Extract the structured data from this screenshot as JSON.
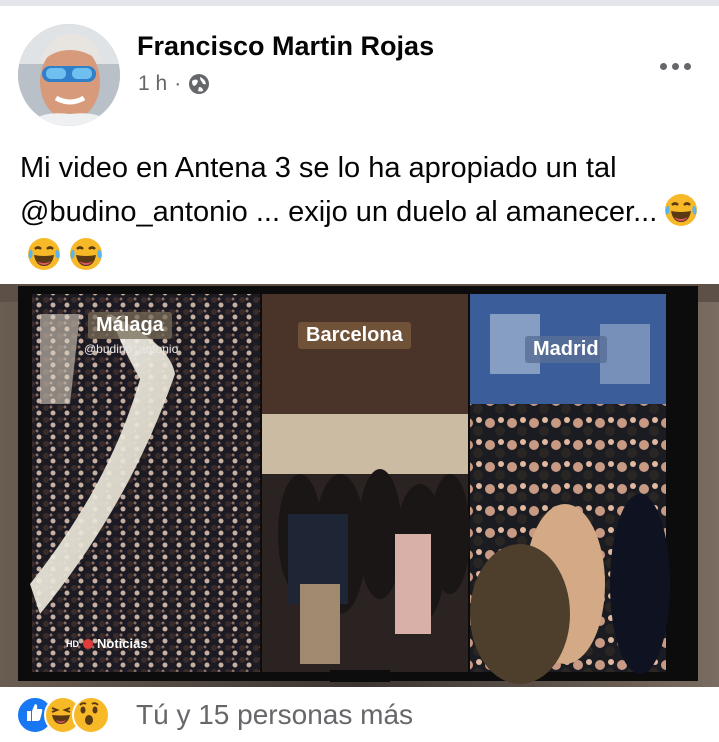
{
  "post": {
    "author": "Francisco Martin Rojas",
    "time": "1 h",
    "separator": "·",
    "text": "Mi video en Antena 3 se lo ha apropiado un tal @budino_antonio ... exijo un duelo al amanecer...",
    "emojis": [
      "laughing-tears-icon",
      "laughing-tears-icon",
      "laughing-tears-icon"
    ]
  },
  "photo": {
    "panels": [
      {
        "city": "Málaga"
      },
      {
        "city": "Barcelona"
      },
      {
        "city": "Madrid"
      }
    ],
    "watermark": "@budino_antonio",
    "logo": "Noticias",
    "logo_hd": "HD"
  },
  "reactions": {
    "icons": [
      "like-icon",
      "haha-icon",
      "wow-icon"
    ],
    "summary": "Tú y 15 personas más"
  },
  "colors": {
    "like_blue": "#1877f2",
    "haha_yellow": "#f7b928",
    "text_primary": "#050505",
    "text_secondary": "#65676b"
  }
}
